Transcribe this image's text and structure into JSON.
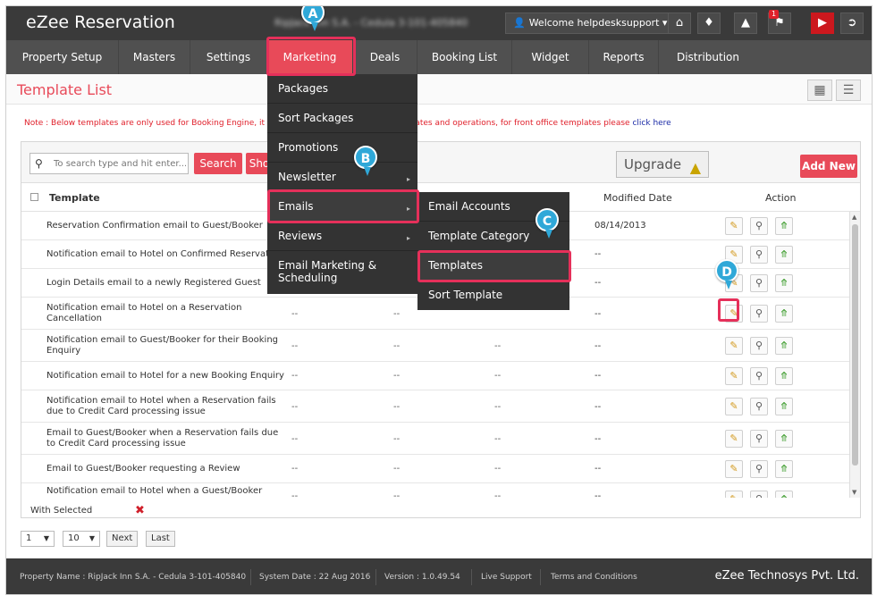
{
  "app": {
    "title": "eZee Reservation",
    "property_blurred": "RipJack Inn S.A. - Cedula 3-101-405840"
  },
  "topbar": {
    "welcome": "Welcome helpdesksupport",
    "notification_count": "1",
    "icons": [
      "home-icon",
      "bell-icon",
      "megaphone-icon",
      "flag-icon",
      "youtube-icon",
      "logout-icon"
    ]
  },
  "nav": {
    "items": [
      {
        "label": "Property Setup"
      },
      {
        "label": "Masters"
      },
      {
        "label": "Settings"
      },
      {
        "label": "Marketing",
        "active": true
      },
      {
        "label": "Deals"
      },
      {
        "label": "Booking List"
      },
      {
        "label": "Widget"
      },
      {
        "label": "Reports"
      },
      {
        "label": "Distribution"
      }
    ]
  },
  "page": {
    "title": "Template List"
  },
  "note": {
    "text_before": "Note : Below templates are only used for Booking Engine, it is",
    "text_after": "lates and operations, for front office templates please",
    "link": "click here"
  },
  "toolbar": {
    "search_placeholder": "To search type and hit enter...",
    "search_button": "Search",
    "show_button": "Sho",
    "upgrade": "Upgrade",
    "add_new": "Add New"
  },
  "table": {
    "headers": {
      "template": "Template",
      "modified": "Modified Date",
      "action": "Action"
    },
    "rows": [
      {
        "name": "Reservation Confirmation email to Guest/Booker",
        "modified": "08/14/2013"
      },
      {
        "name": "Notification email to Hotel on Confirmed Reservation",
        "modified": "--"
      },
      {
        "name": "Login Details email to a newly Registered Guest",
        "modified": "--"
      },
      {
        "name": "Notification email to Hotel on a Reservation Cancellation",
        "modified": "--"
      },
      {
        "name": "Notification email to Guest/Booker for their Booking Enquiry",
        "modified": "--"
      },
      {
        "name": "Notification email to Hotel for a new Booking Enquiry",
        "modified": "--"
      },
      {
        "name": "Notification email to Hotel when a Reservation fails due to Credit Card processing issue",
        "modified": "--"
      },
      {
        "name": "Email to Guest/Booker when a Reservation fails due to Credit Card processing issue",
        "modified": "--"
      },
      {
        "name": "Email to Guest/Booker requesting a Review",
        "modified": "--"
      },
      {
        "name": "Notification email to Hotel when a Guest/Booker",
        "modified": "--"
      }
    ],
    "dash": "--"
  },
  "bulk": {
    "with_selected": "With Selected"
  },
  "pager": {
    "page": "1",
    "per_page": "10",
    "next": "Next",
    "last": "Last"
  },
  "footer": {
    "property": "Property Name : RipJack Inn S.A. - Cedula 3-101-405840",
    "system_date": "System Date : 22 Aug 2016",
    "version": "Version : 1.0.49.54",
    "live_support": "Live Support",
    "terms": "Terms and Conditions",
    "company": "eZee Technosys Pvt. Ltd."
  },
  "marketing_menu": {
    "items": [
      {
        "label": "Packages"
      },
      {
        "label": "Sort Packages"
      },
      {
        "label": "Promotions"
      },
      {
        "label": "Newsletter",
        "submenu": true
      },
      {
        "label": "Emails",
        "submenu": true,
        "highlighted": true
      },
      {
        "label": "Reviews",
        "submenu": true
      },
      {
        "label": "Email Marketing & Scheduling"
      }
    ]
  },
  "emails_menu": {
    "items": [
      {
        "label": "Email Accounts"
      },
      {
        "label": "Template Category"
      },
      {
        "label": "Templates",
        "highlighted": true
      },
      {
        "label": "Sort Template"
      }
    ]
  },
  "callouts": [
    "A",
    "B",
    "C",
    "D"
  ],
  "colors": {
    "accent": "#e84a59",
    "highlight": "#e5305a",
    "callout": "#2fa8d8",
    "topbar": "#3a3a3a",
    "navbar": "#505050"
  }
}
